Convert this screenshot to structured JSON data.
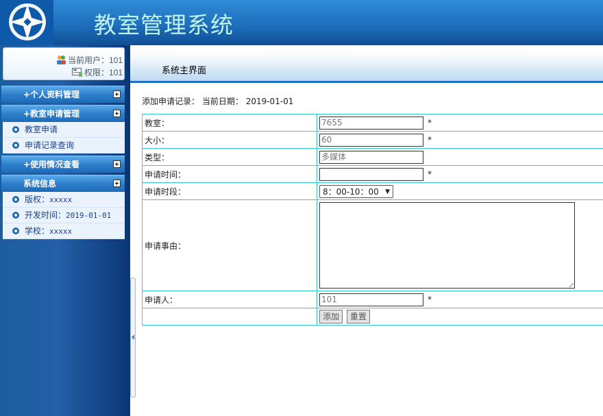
{
  "header": {
    "app_title": "教室管理系统",
    "logo": "logo-icon"
  },
  "user_panel": {
    "current_user": "当前用户：101",
    "permission": "权限：101"
  },
  "tab": {
    "title": "系统主界面"
  },
  "menu": {
    "personal": {
      "label": "+个人资料管理"
    },
    "classroom_apply": {
      "label": "+教室申请管理",
      "items": [
        "教室申请",
        "申请记录查询"
      ]
    },
    "usage": {
      "label": "+使用情况查看"
    },
    "system_info": {
      "label": "系统信息",
      "items": [
        {
          "label": "版权：",
          "value": "xxxxx"
        },
        {
          "label": "开发时间：",
          "value": "2019-01-01"
        },
        {
          "label": "学校：",
          "value": "xxxxx"
        }
      ]
    }
  },
  "form": {
    "heading": "添加申请记录：",
    "date_label": "当前日期：",
    "date_value": "2019-01-01",
    "required_mark": "*",
    "rows": {
      "classroom": {
        "label": "教室：",
        "value": "7655"
      },
      "size": {
        "label": "大小：",
        "value": "60"
      },
      "type": {
        "label": "类型：",
        "value": "多媒体"
      },
      "apply_time": {
        "label": "申请时间：",
        "value": ""
      },
      "apply_period": {
        "label": "申请时段：",
        "value": "8：00-10：00"
      },
      "reason": {
        "label": "申请事由：",
        "value": ""
      },
      "applicant": {
        "label": "申请人：",
        "value": "101"
      }
    },
    "buttons": {
      "add": "添加",
      "reset": "重置"
    }
  },
  "colors": {
    "header": "#1e6fbd",
    "title": "#bff3ea",
    "table_border": "#33cccc",
    "menu_text": "#1a3f8f"
  }
}
